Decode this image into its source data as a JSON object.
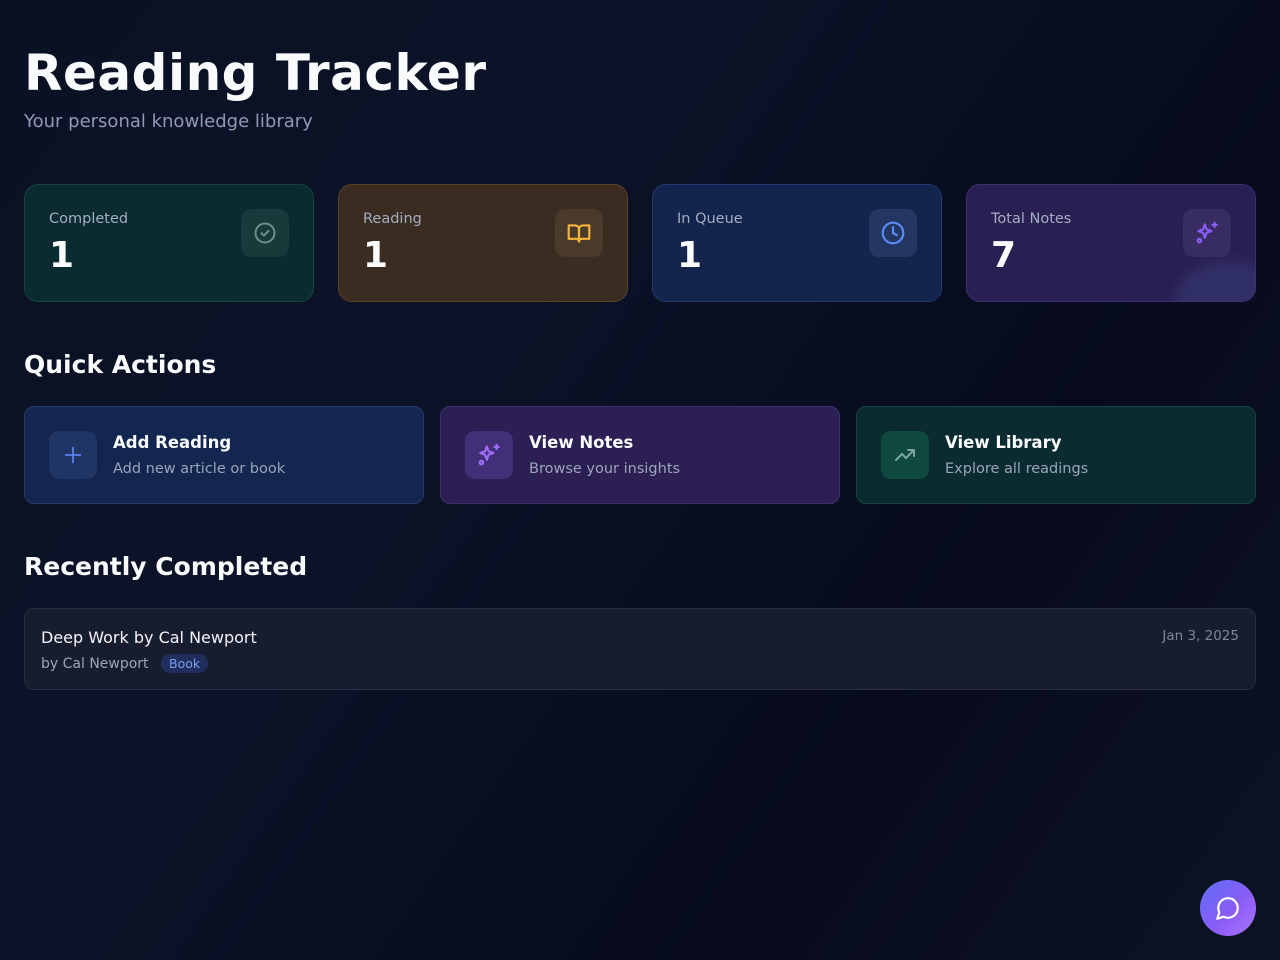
{
  "header": {
    "title": "Reading Tracker",
    "subtitle": "Your personal knowledge library"
  },
  "stats": [
    {
      "label": "Completed",
      "value": "1",
      "icon": "check-circle-icon",
      "accent": "#6b8f8a"
    },
    {
      "label": "Reading",
      "value": "1",
      "icon": "book-open-icon",
      "accent": "#f5b73b"
    },
    {
      "label": "In Queue",
      "value": "1",
      "icon": "clock-icon",
      "accent": "#5b8cf5"
    },
    {
      "label": "Total Notes",
      "value": "7",
      "icon": "sparkles-icon",
      "accent": "#8b5cf6"
    }
  ],
  "quick_actions": {
    "title": "Quick Actions",
    "items": [
      {
        "title": "Add Reading",
        "subtitle": "Add new article or book",
        "icon": "plus-icon",
        "accent": "#5b7ff0"
      },
      {
        "title": "View Notes",
        "subtitle": "Browse your insights",
        "icon": "sparkles-icon",
        "accent": "#a06bf5"
      },
      {
        "title": "View Library",
        "subtitle": "Explore all readings",
        "icon": "trending-up-icon",
        "accent": "#7aa59d"
      }
    ]
  },
  "recently_completed": {
    "title": "Recently Completed",
    "items": [
      {
        "title": "Deep Work by Cal Newport",
        "author": "by Cal Newport",
        "type": "Book",
        "date": "Jan 3, 2025"
      }
    ]
  },
  "chat_button": {
    "icon": "chat-bubble-icon"
  }
}
